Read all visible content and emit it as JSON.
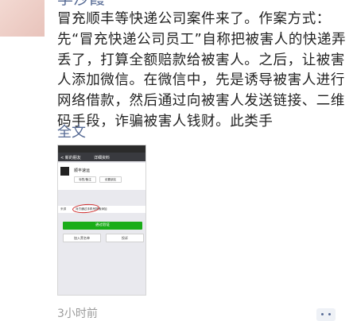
{
  "post": {
    "author_name": "李沙霞",
    "text": "冒充顺丰等快递公司案件来了。作案方式：先“冒充快递公司员工”自称把被害人的快递弄丢了，打算全额赔款给被害人。之后，让被害人添加微信。在微信中，先是诱导被害人进行网络借款，然后通过向被害人发送链接、二维码手段，诈骗被害人钱财。此类手",
    "full_text_link": "全文",
    "time": "3小时前"
  },
  "embedded_screenshot": {
    "nav_back": "< 新的朋友",
    "nav_title": "详细资料",
    "nickname": "顺丰速运",
    "btn_left": "标签/备注",
    "btn_right": "设置朋友",
    "from_label": "来源",
    "from_value": "对方通过手机号搜索添加",
    "pass_button": "通过验证",
    "blacklist_button": "加入黑名单",
    "complain_button": "投诉"
  }
}
